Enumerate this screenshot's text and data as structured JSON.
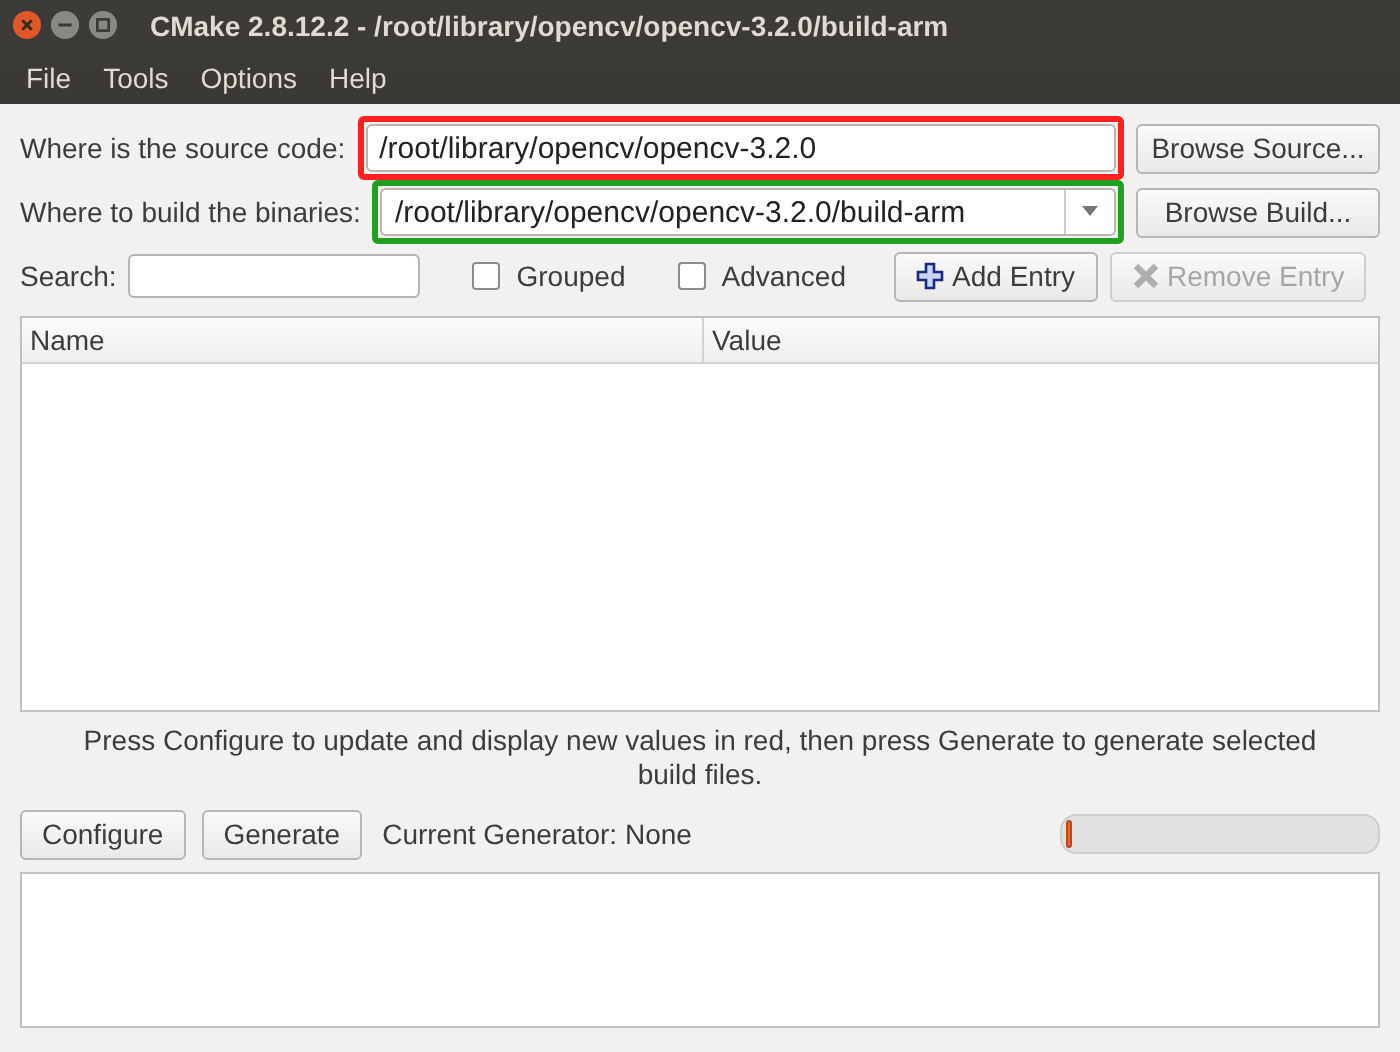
{
  "window": {
    "title": "CMake 2.8.12.2 - /root/library/opencv/opencv-3.2.0/build-arm"
  },
  "menu": [
    "File",
    "Tools",
    "Options",
    "Help"
  ],
  "paths": [
    {
      "label": "Where is the source code:",
      "value": "/root/library/opencv/opencv-3.2.0",
      "kind": "text",
      "color": "#ff2020",
      "button": "Browse Source..."
    },
    {
      "label": "Where to build the binaries:",
      "value": "/root/library/opencv/opencv-3.2.0/build-arm",
      "kind": "combo",
      "color": "#20a020",
      "button": "Browse Build..."
    }
  ],
  "search": {
    "label": "Search:"
  },
  "options": [
    {
      "label": "Grouped",
      "checked": false
    },
    {
      "label": "Advanced",
      "checked": false
    }
  ],
  "entry_buttons": [
    {
      "label": "Add Entry",
      "kind": "add",
      "disabled": false
    },
    {
      "label": "Remove Entry",
      "kind": "remove",
      "disabled": true
    }
  ],
  "table": {
    "columns": [
      "Name",
      "Value"
    ]
  },
  "message": "Press Configure to update and display new values in red, then press Generate to generate selected build files.",
  "actions": [
    "Configure",
    "Generate"
  ],
  "generator": "Current Generator: None",
  "progress": {
    "level": 0.02
  }
}
